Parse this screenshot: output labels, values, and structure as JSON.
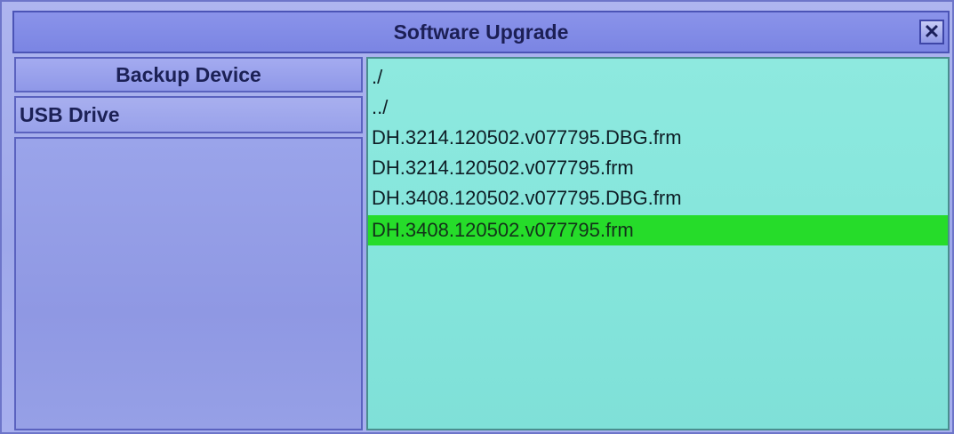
{
  "window": {
    "title": "Software Upgrade",
    "close_label": "✕"
  },
  "devices": {
    "header": "Backup Device",
    "items": [
      {
        "label": "USB Drive"
      }
    ]
  },
  "files": {
    "items": [
      {
        "label": "./"
      },
      {
        "label": "../"
      },
      {
        "label": "DH.3214.120502.v077795.DBG.frm"
      },
      {
        "label": "DH.3214.120502.v077795.frm"
      },
      {
        "label": "DH.3408.120502.v077795.DBG.frm"
      },
      {
        "label": "DH.3408.120502.v077795.frm",
        "selected": true
      }
    ]
  },
  "colors": {
    "selected_row": "#26dc2a",
    "file_panel": "#86e6dc",
    "window_bg": "#9ea8ea"
  }
}
